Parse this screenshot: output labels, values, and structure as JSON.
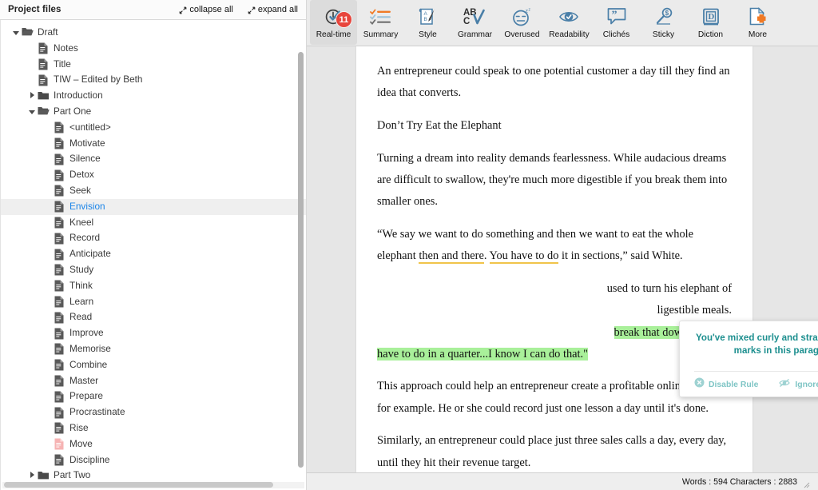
{
  "sidebar": {
    "title": "Project files",
    "collapse_label": "collapse all",
    "expand_label": "expand all",
    "tree": [
      {
        "label": "Draft",
        "type": "folder-open",
        "depth": 0,
        "disclosure": "open",
        "selected": false
      },
      {
        "label": "Notes",
        "type": "file",
        "depth": 1,
        "disclosure": "none",
        "selected": false
      },
      {
        "label": "Title",
        "type": "file",
        "depth": 1,
        "disclosure": "none",
        "selected": false
      },
      {
        "label": "TIW – Edited by Beth",
        "type": "file",
        "depth": 1,
        "disclosure": "none",
        "selected": false
      },
      {
        "label": "Introduction",
        "type": "folder-closed",
        "depth": 1,
        "disclosure": "closed",
        "selected": false
      },
      {
        "label": "Part One",
        "type": "folder-open",
        "depth": 1,
        "disclosure": "open",
        "selected": false
      },
      {
        "label": "<untitled>",
        "type": "file",
        "depth": 2,
        "disclosure": "none",
        "selected": false
      },
      {
        "label": "Motivate",
        "type": "file",
        "depth": 2,
        "disclosure": "none",
        "selected": false
      },
      {
        "label": "Silence",
        "type": "file",
        "depth": 2,
        "disclosure": "none",
        "selected": false
      },
      {
        "label": "Detox",
        "type": "file",
        "depth": 2,
        "disclosure": "none",
        "selected": false
      },
      {
        "label": "Seek",
        "type": "file",
        "depth": 2,
        "disclosure": "none",
        "selected": false
      },
      {
        "label": "Envision",
        "type": "file",
        "depth": 2,
        "disclosure": "none",
        "selected": true
      },
      {
        "label": "Kneel",
        "type": "file",
        "depth": 2,
        "disclosure": "none",
        "selected": false
      },
      {
        "label": "Record",
        "type": "file",
        "depth": 2,
        "disclosure": "none",
        "selected": false
      },
      {
        "label": "Anticipate",
        "type": "file",
        "depth": 2,
        "disclosure": "none",
        "selected": false
      },
      {
        "label": "Study",
        "type": "file",
        "depth": 2,
        "disclosure": "none",
        "selected": false
      },
      {
        "label": "Think",
        "type": "file",
        "depth": 2,
        "disclosure": "none",
        "selected": false
      },
      {
        "label": "Learn",
        "type": "file",
        "depth": 2,
        "disclosure": "none",
        "selected": false
      },
      {
        "label": "Read",
        "type": "file",
        "depth": 2,
        "disclosure": "none",
        "selected": false
      },
      {
        "label": "Improve",
        "type": "file",
        "depth": 2,
        "disclosure": "none",
        "selected": false
      },
      {
        "label": "Memorise",
        "type": "file",
        "depth": 2,
        "disclosure": "none",
        "selected": false
      },
      {
        "label": "Combine",
        "type": "file",
        "depth": 2,
        "disclosure": "none",
        "selected": false
      },
      {
        "label": "Master",
        "type": "file",
        "depth": 2,
        "disclosure": "none",
        "selected": false
      },
      {
        "label": "Prepare",
        "type": "file",
        "depth": 2,
        "disclosure": "none",
        "selected": false
      },
      {
        "label": "Procrastinate",
        "type": "file",
        "depth": 2,
        "disclosure": "none",
        "selected": false
      },
      {
        "label": "Rise",
        "type": "file",
        "depth": 2,
        "disclosure": "none",
        "selected": false
      },
      {
        "label": "Move",
        "type": "file-pink",
        "depth": 2,
        "disclosure": "none",
        "selected": false
      },
      {
        "label": "Discipline",
        "type": "file",
        "depth": 2,
        "disclosure": "none",
        "selected": false
      },
      {
        "label": "Part Two",
        "type": "folder-closed",
        "depth": 1,
        "disclosure": "closed",
        "selected": false
      }
    ]
  },
  "toolbar": {
    "items": [
      {
        "label": "Real-time",
        "icon": "clock-check-icon",
        "active": true,
        "badge": "11"
      },
      {
        "label": "Summary",
        "icon": "checklist-icon",
        "active": false,
        "badge": ""
      },
      {
        "label": "Style",
        "icon": "scroll-quill-icon",
        "active": false,
        "badge": ""
      },
      {
        "label": "Grammar",
        "icon": "abc-check-icon",
        "active": false,
        "badge": ""
      },
      {
        "label": "Overused",
        "icon": "sleepy-face-icon",
        "active": false,
        "badge": ""
      },
      {
        "label": "Readability",
        "icon": "eye-check-icon",
        "active": false,
        "badge": ""
      },
      {
        "label": "Clichés",
        "icon": "quote-bubble-icon",
        "active": false,
        "badge": ""
      },
      {
        "label": "Sticky",
        "icon": "honey-dipper-icon",
        "active": false,
        "badge": ""
      },
      {
        "label": "Diction",
        "icon": "dictionary-icon",
        "active": false,
        "badge": ""
      },
      {
        "label": "More",
        "icon": "page-plus-icon",
        "active": false,
        "badge": ""
      }
    ],
    "badge_color": "#e8453c"
  },
  "document": {
    "paragraphs": [
      {
        "id": "p1",
        "text": "An entrepreneur could speak to one potential customer a day till they find an idea that converts."
      },
      {
        "id": "p2",
        "text": "Don’t Try Eat the Elephant"
      },
      {
        "id": "p3",
        "text": "Turning a dream into reality demands fearlessness.  While audacious dreams are difficult to swallow, they're much more digestible if you break them into smaller ones."
      }
    ],
    "quote_paragraph": {
      "lead": "“We say we want to do something and then we want to eat the whole elephant ",
      "warn1": "then and there",
      "mid1": ". ",
      "warn2": "You have to do",
      "tail": " it in sections,” said White."
    },
    "hidden_paragraph": {
      "line1_tail": "used to turn his elephant of",
      "line2_tail": "ligestible meals."
    },
    "highlight_paragraph": {
      "line1": "break that down to what I",
      "line2": "have to do in a quarter...I know I can do that.\""
    },
    "paragraphs_after": [
      {
        "id": "p6",
        "text": "This approach could help an entrepreneur create a profitable online course for example. He or she could record just one lesson a day until it's done."
      },
      {
        "id": "p7",
        "text": "Similarly, an entrepreneur could place just three sales calls a day, every day, until they hit their revenue target."
      }
    ],
    "highlight_color": "#a9f09a",
    "warning_underline_color": "#f0c44a"
  },
  "popup": {
    "message": "You've mixed curly and straight quotation marks in this paragraph.",
    "disable_rule_label": "Disable Rule",
    "ignore_label": "Ignore",
    "text_color": "#1d8f8f",
    "action_color": "#7fc5c5"
  },
  "statusbar": {
    "text": "Words : 594 Characters : 2883",
    "words": 594,
    "characters": 2883
  }
}
